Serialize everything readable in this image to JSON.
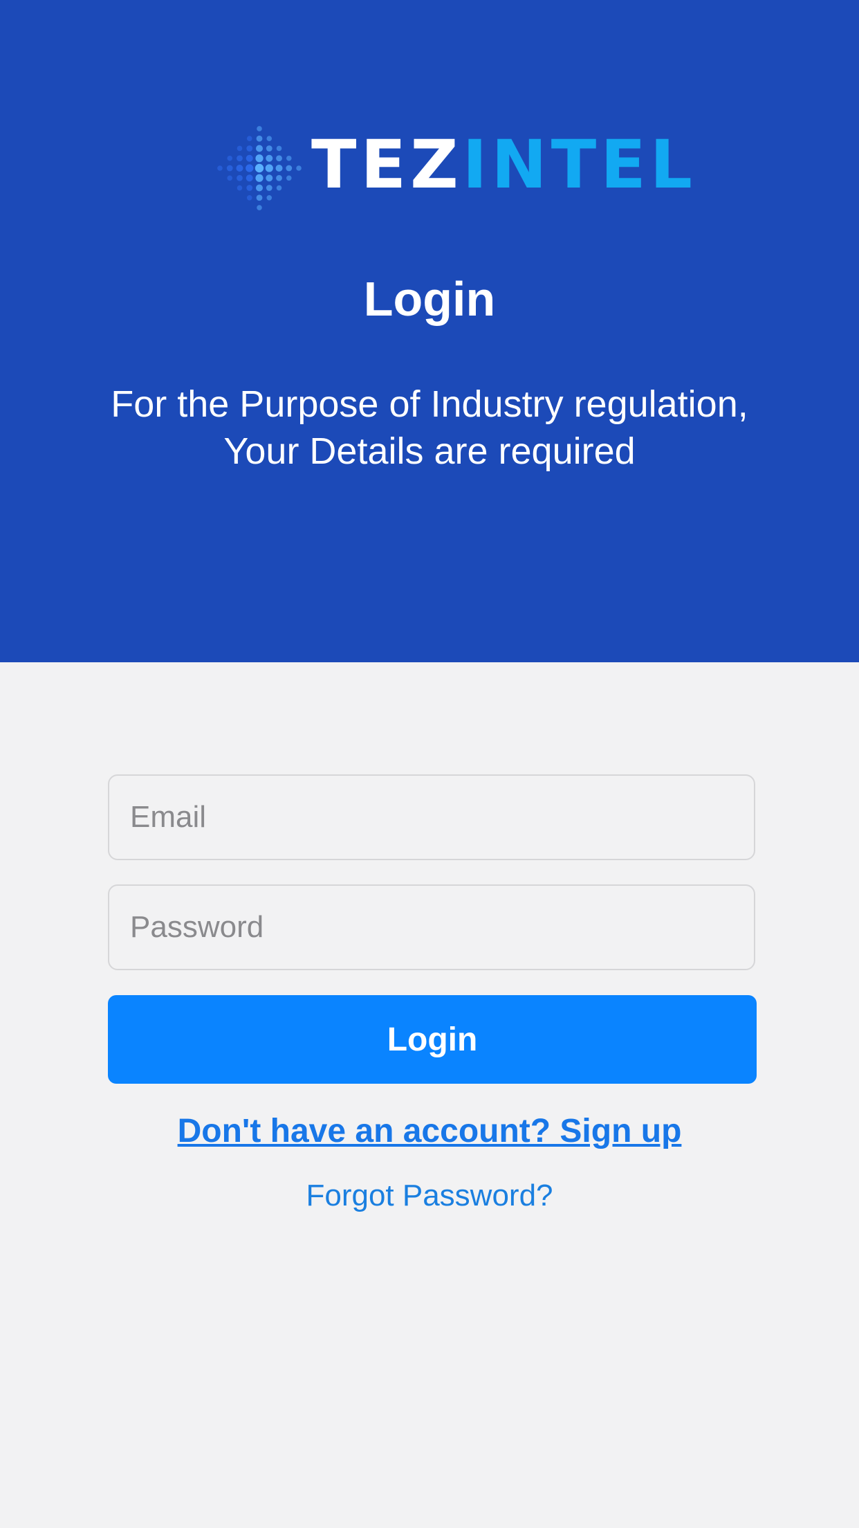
{
  "colors": {
    "header_bg": "#1c4ab8",
    "page_bg": "#f2f2f3",
    "button_bg": "#0a84ff",
    "link": "#1877e8",
    "logo_accent": "#12a9f2"
  },
  "logo": {
    "text_part1": "TEZ",
    "text_part2": "INTEL",
    "icon": "diamond-dots-icon"
  },
  "header": {
    "title": "Login",
    "subtitle_line1": "For the Purpose of Industry regulation,",
    "subtitle_line2": "Your Details are required"
  },
  "form": {
    "email": {
      "placeholder": "Email",
      "value": ""
    },
    "password": {
      "placeholder": "Password",
      "value": ""
    },
    "login_label": "Login"
  },
  "links": {
    "signup": "Don't have an account? Sign up",
    "forgot": "Forgot Password?"
  }
}
